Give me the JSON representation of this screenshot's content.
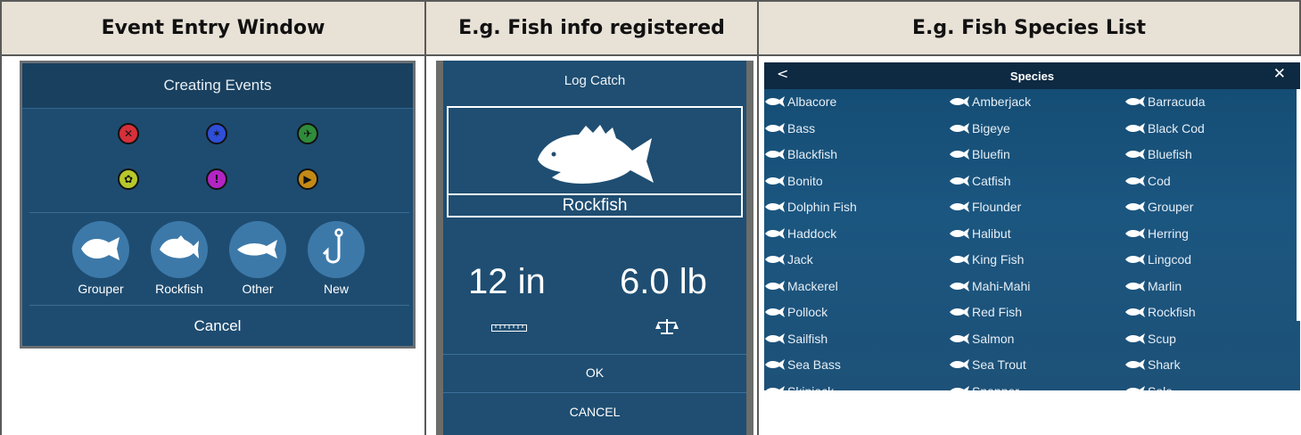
{
  "headers": [
    "Event Entry Window",
    "E.g. Fish info registered",
    "E.g. Fish Species List"
  ],
  "event_entry": {
    "title": "Creating Events",
    "event_icons": [
      {
        "name": "mark-icon",
        "color": "#d6303a",
        "glyph": "✕"
      },
      {
        "name": "flag-icon",
        "color": "#2f4fd8",
        "glyph": "✶"
      },
      {
        "name": "bird-icon",
        "color": "#2f8c3a",
        "glyph": "✈"
      },
      {
        "name": "crab-icon",
        "color": "#b7c82c",
        "glyph": "✿"
      },
      {
        "name": "alert-icon",
        "color": "#b324c4",
        "glyph": "!"
      },
      {
        "name": "play-icon",
        "color": "#c48a16",
        "glyph": "▶"
      }
    ],
    "quick_buttons": [
      "Grouper",
      "Rockfish",
      "Other",
      "New"
    ],
    "cancel_label": "Cancel"
  },
  "log_catch": {
    "title": "Log Catch",
    "fish_name": "Rockfish",
    "length": "12 in",
    "weight": "6.0 lb",
    "ok_label": "OK",
    "cancel_label": "CANCEL"
  },
  "species_list": {
    "title": "Species",
    "back_glyph": "<",
    "close_glyph": "✕",
    "columns": [
      [
        "Albacore",
        "Bass",
        "Blackfish",
        "Bonito",
        "Dolphin Fish",
        "Haddock",
        "Jack",
        "Mackerel",
        "Pollock",
        "Sailfish",
        "Sea Bass",
        "Skipjack"
      ],
      [
        "Amberjack",
        "Bigeye",
        "Bluefin",
        "Catfish",
        "Flounder",
        "Halibut",
        "King Fish",
        "Mahi-Mahi",
        "Red Fish",
        "Salmon",
        "Sea Trout",
        "Snapper"
      ],
      [
        "Barracuda",
        "Black Cod",
        "Bluefish",
        "Cod",
        "Grouper",
        "Herring",
        "Lingcod",
        "Marlin",
        "Rockfish",
        "Scup",
        "Shark",
        "Sole"
      ]
    ]
  }
}
